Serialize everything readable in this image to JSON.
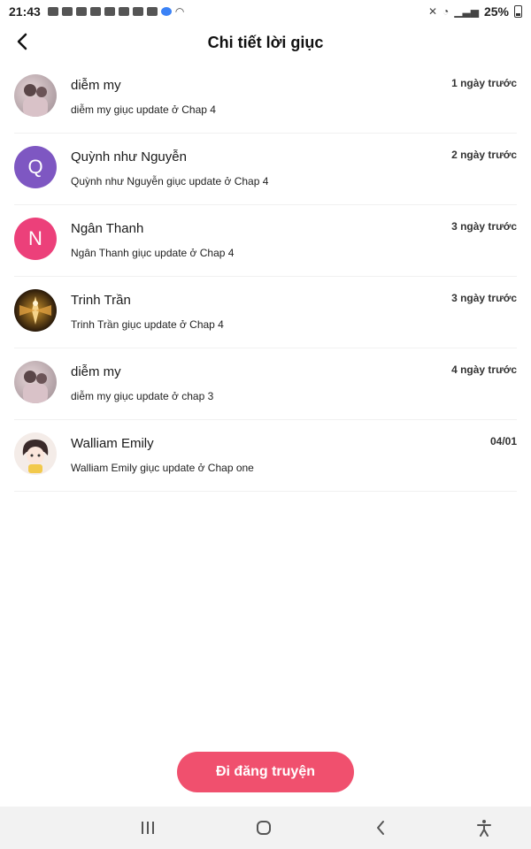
{
  "status_bar": {
    "time": "21:43",
    "battery": "25%",
    "notification_icons": [
      "youtube-icon",
      "youtube-icon",
      "app-icon",
      "app-icon",
      "instagram-icon",
      "gmail-icon",
      "youtube-icon",
      "gallery-icon",
      "messenger-icon",
      "wifi-icon"
    ]
  },
  "header": {
    "title": "Chi tiết lời giục"
  },
  "items": [
    {
      "name": "diễm my",
      "time": "1 ngày trước",
      "desc": "diễm my giục update ở Chap 4",
      "avatar": "photo",
      "avatar_color": "#b9a3a6"
    },
    {
      "name": "Quỳnh như Nguyễn",
      "time": "2 ngày trước",
      "desc": "Quỳnh như Nguyễn giục update ở Chap 4",
      "avatar": "Q",
      "avatar_color": "#7e57c2"
    },
    {
      "name": "Ngân Thanh",
      "time": "3 ngày trước",
      "desc": "Ngân Thanh giục update ở Chap 4",
      "avatar": "N",
      "avatar_color": "#ec407a"
    },
    {
      "name": "Trinh Trần",
      "time": "3 ngày trước",
      "desc": "Trinh Trần giục update ở Chap 4",
      "avatar": "photo",
      "avatar_color": "#2a1a0a"
    },
    {
      "name": "diễm my",
      "time": "4 ngày trước",
      "desc": "diễm my giục update ở chap 3",
      "avatar": "photo",
      "avatar_color": "#b9a3a6"
    },
    {
      "name": "Walliam Emily",
      "time": "04/01",
      "desc": "Walliam Emily giục update ở Chap one",
      "avatar": "photo",
      "avatar_color": "#f4ece8"
    }
  ],
  "cta": {
    "label": "Đi đăng truyện",
    "color": "#f0506e"
  },
  "navbar": {
    "buttons": [
      "recent-apps-icon",
      "home-icon",
      "back-icon",
      "accessibility-icon"
    ]
  }
}
